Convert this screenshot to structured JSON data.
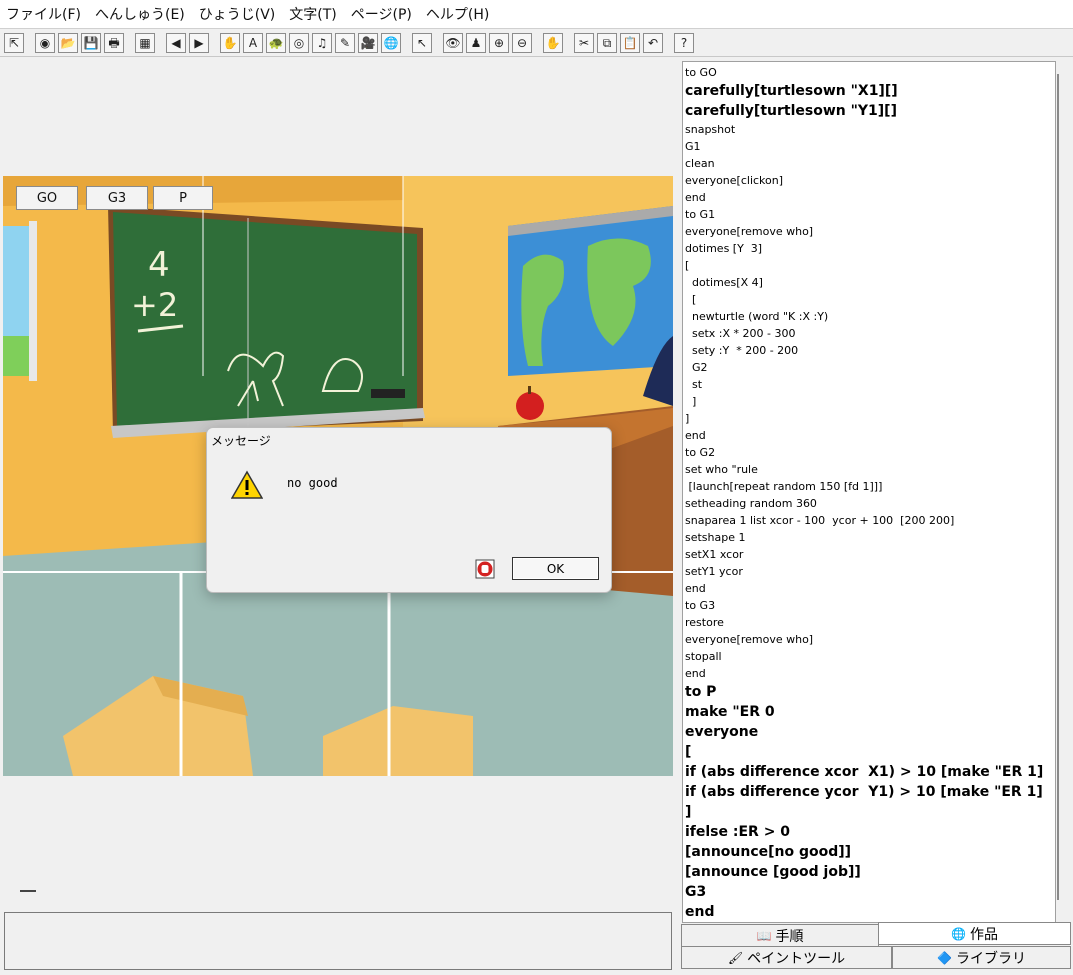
{
  "menu": {
    "items": [
      "ファイル(F)",
      "へんしゅう(E)",
      "ひょうじ(V)",
      "文字(T)",
      "ページ(P)",
      "ヘルプ(H)"
    ]
  },
  "toolbar": {
    "buttons": [
      {
        "icon": "pointer-arrow-icon",
        "glyph": "⇱"
      },
      {
        "icon": "new-globe-icon",
        "glyph": "◉"
      },
      {
        "icon": "open-folder-icon",
        "glyph": "📂"
      },
      {
        "icon": "save-disk-icon",
        "glyph": "💾"
      },
      {
        "icon": "print-icon",
        "glyph": "🖶"
      },
      {
        "icon": "layout-icon",
        "glyph": "▦"
      },
      {
        "icon": "prev-page-icon",
        "glyph": "◀"
      },
      {
        "icon": "next-page-icon",
        "glyph": "▶"
      },
      {
        "icon": "hand-icon",
        "glyph": "✋"
      },
      {
        "icon": "text-box-icon",
        "glyph": "A"
      },
      {
        "icon": "turtle-icon",
        "glyph": "🐢"
      },
      {
        "icon": "eye-icon",
        "glyph": "◎"
      },
      {
        "icon": "music-note-icon",
        "glyph": "♫"
      },
      {
        "icon": "pen-icon",
        "glyph": "✎"
      },
      {
        "icon": "video-camera-icon",
        "glyph": "🎥"
      },
      {
        "icon": "globe-icon",
        "glyph": "🌐"
      },
      {
        "icon": "select-arrow-icon",
        "glyph": "↖"
      },
      {
        "icon": "show-eye-icon",
        "glyph": "👁"
      },
      {
        "icon": "stamp-icon",
        "glyph": "♟"
      },
      {
        "icon": "zoom-in-icon",
        "glyph": "⊕"
      },
      {
        "icon": "zoom-out-icon",
        "glyph": "⊖"
      },
      {
        "icon": "stop-hand-icon",
        "glyph": "✋"
      },
      {
        "icon": "cut-scissors-icon",
        "glyph": "✂"
      },
      {
        "icon": "copy-icon",
        "glyph": "⧉"
      },
      {
        "icon": "paste-icon",
        "glyph": "📋"
      },
      {
        "icon": "undo-icon",
        "glyph": "↶"
      },
      {
        "icon": "help-question-icon",
        "glyph": "?"
      }
    ]
  },
  "stage": {
    "buttons": [
      "GO",
      "G3",
      "P"
    ]
  },
  "dialog": {
    "title": "メッセージ",
    "message": "no good",
    "ok_label": "OK"
  },
  "code": {
    "lines": [
      {
        "text": "to GO",
        "size": "small"
      },
      {
        "text": "carefully[turtlesown \"X1][]",
        "size": "big"
      },
      {
        "text": "carefully[turtlesown \"Y1][]",
        "size": "big"
      },
      {
        "text": "snapshot",
        "size": "small"
      },
      {
        "text": "G1",
        "size": "small"
      },
      {
        "text": "clean",
        "size": "small"
      },
      {
        "text": "everyone[clickon]",
        "size": "small"
      },
      {
        "text": "end",
        "size": "small"
      },
      {
        "text": "to G1",
        "size": "small"
      },
      {
        "text": "everyone[remove who]",
        "size": "small"
      },
      {
        "text": "dotimes [Y  3]",
        "size": "small"
      },
      {
        "text": "[",
        "size": "small"
      },
      {
        "text": "  dotimes[X 4]",
        "size": "small"
      },
      {
        "text": "  [",
        "size": "small"
      },
      {
        "text": "  newturtle (word \"K :X :Y)",
        "size": "small"
      },
      {
        "text": "  setx :X * 200 - 300",
        "size": "small"
      },
      {
        "text": "  sety :Y  * 200 - 200",
        "size": "small"
      },
      {
        "text": "  G2",
        "size": "small"
      },
      {
        "text": "  st",
        "size": "small"
      },
      {
        "text": "  ]",
        "size": "small"
      },
      {
        "text": "]",
        "size": "small"
      },
      {
        "text": "end",
        "size": "small"
      },
      {
        "text": "to G2",
        "size": "small"
      },
      {
        "text": "set who \"rule",
        "size": "small"
      },
      {
        "text": " [launch[repeat random 150 [fd 1]]]",
        "size": "small"
      },
      {
        "text": "setheading random 360",
        "size": "small"
      },
      {
        "text": "snaparea 1 list xcor - 100  ycor + 100  [200 200]",
        "size": "small"
      },
      {
        "text": "setshape 1",
        "size": "small"
      },
      {
        "text": "setX1 xcor",
        "size": "small"
      },
      {
        "text": "setY1 ycor",
        "size": "small"
      },
      {
        "text": "end",
        "size": "small"
      },
      {
        "text": "to G3",
        "size": "small"
      },
      {
        "text": "restore",
        "size": "small"
      },
      {
        "text": "everyone[remove who]",
        "size": "small"
      },
      {
        "text": "stopall",
        "size": "small"
      },
      {
        "text": "end",
        "size": "small"
      },
      {
        "text": "to P",
        "size": "big"
      },
      {
        "text": "make \"ER 0",
        "size": "big"
      },
      {
        "text": "everyone",
        "size": "big"
      },
      {
        "text": "[",
        "size": "big"
      },
      {
        "text": "if (abs difference xcor  X1) > 10 [make \"ER 1]",
        "size": "big"
      },
      {
        "text": "if (abs difference ycor  Y1) > 10 [make \"ER 1]",
        "size": "big"
      },
      {
        "text": "]",
        "size": "big"
      },
      {
        "text": "ifelse :ER > 0",
        "size": "big"
      },
      {
        "text": "[announce[no good]]",
        "size": "big"
      },
      {
        "text": "[announce [good job]]",
        "size": "big"
      },
      {
        "text": "G3",
        "size": "big"
      },
      {
        "text": "end",
        "size": "big"
      }
    ]
  },
  "tabs": {
    "procedures": "手順",
    "works": "作品",
    "paint_tool": "ペイントツール",
    "library": "ライブラリ"
  },
  "colors": {
    "wall": "#f4b94a",
    "floor": "#9dbcb5",
    "board": "#2f6e39"
  }
}
